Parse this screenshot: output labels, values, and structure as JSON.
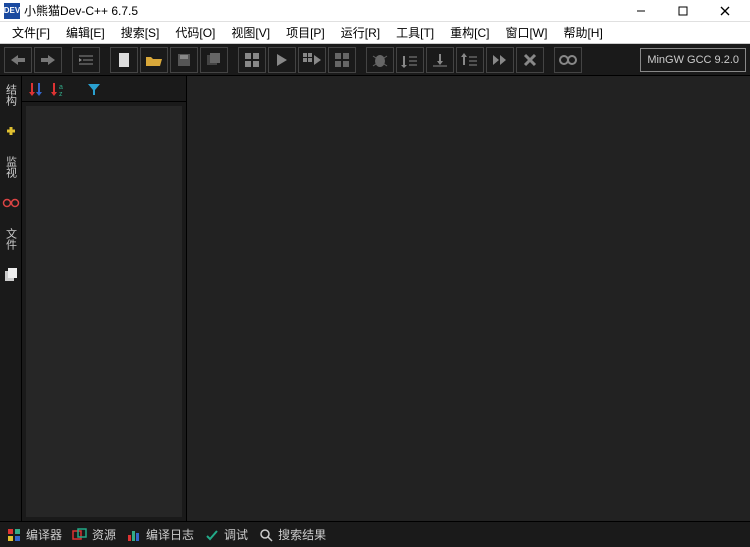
{
  "window": {
    "title": "小熊猫Dev-C++ 6.7.5",
    "app_icon_label": "DEV"
  },
  "menu": {
    "items": [
      "文件[F]",
      "编辑[E]",
      "搜索[S]",
      "代码[O]",
      "视图[V]",
      "项目[P]",
      "运行[R]",
      "工具[T]",
      "重构[C]",
      "窗口[W]",
      "帮助[H]"
    ]
  },
  "toolbar": {
    "profile": "MinGW GCC 9.2.0"
  },
  "left_gutter": {
    "tab1": "结构",
    "tab2": "监视",
    "tab3": "文件"
  },
  "bottom": {
    "compiler": "编译器",
    "resources": "资源",
    "log": "编译日志",
    "debug": "调试",
    "search": "搜索结果"
  }
}
